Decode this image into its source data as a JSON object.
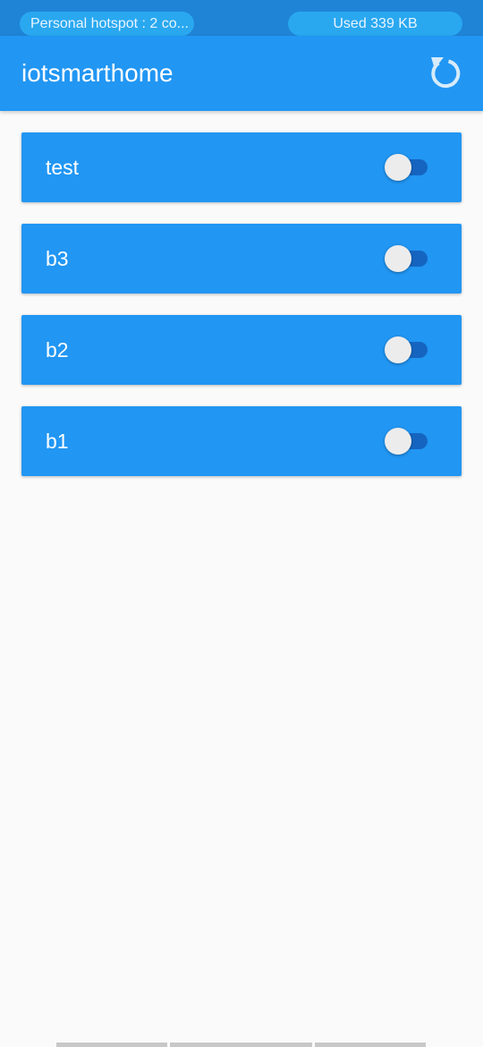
{
  "status_bar": {
    "hotspot_text": "Personal hotspot : 2 co...",
    "data_used_text": "Used  339 KB"
  },
  "app_bar": {
    "title": "iotsmarthome",
    "refresh_icon": "refresh-icon"
  },
  "devices": [
    {
      "label": "test",
      "on": false
    },
    {
      "label": "b3",
      "on": false
    },
    {
      "label": "b2",
      "on": false
    },
    {
      "label": "b1",
      "on": false
    }
  ],
  "colors": {
    "primary": "#2196f3",
    "status_bar": "#1f84d6",
    "pill": "#29a8f0",
    "switch_track": "#1565c0",
    "switch_thumb": "#ececec",
    "background": "#fafafa"
  }
}
